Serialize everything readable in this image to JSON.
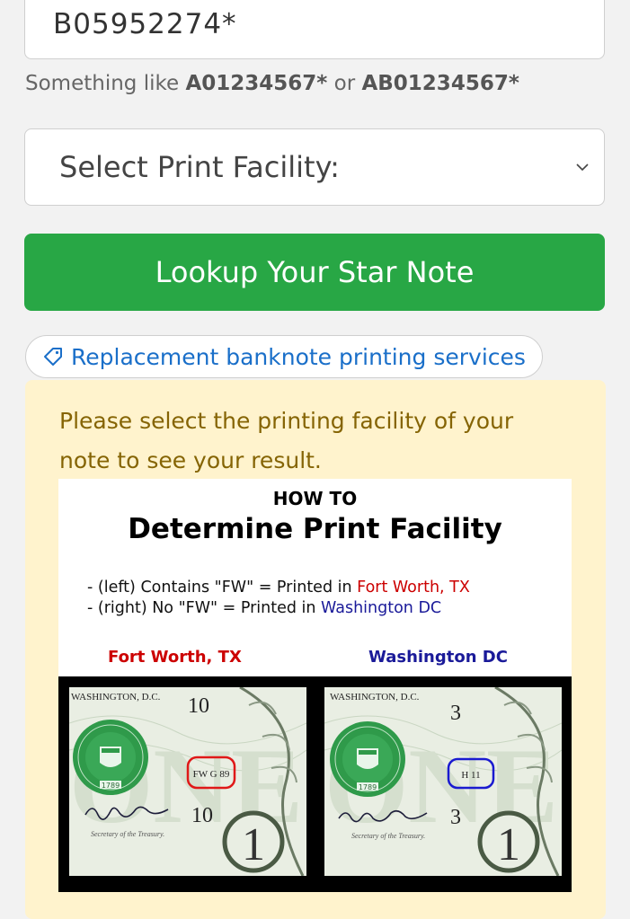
{
  "form": {
    "serial_value": "B05952274*",
    "hint_prefix": "Something like ",
    "hint_example1": "A01234567*",
    "hint_or": " or ",
    "hint_example2": "AB01234567*",
    "select_value": "Select Print Facility:",
    "lookup_label": "Lookup Your Star Note",
    "services_label": "Replacement banknote printing services"
  },
  "alert": {
    "text": "Please select the printing facility of your note to see your result."
  },
  "infographic": {
    "how_to": "HOW TO",
    "title": "Determine Print Facility",
    "rule1_prefix": "- (left) Contains \"FW\" = Printed in ",
    "rule1_place": "Fort Worth, TX",
    "rule2_prefix": "- (right) No \"FW\" = Printed in ",
    "rule2_place": "Washington DC",
    "label_left": "Fort Worth, TX",
    "label_right": "Washington DC",
    "left_note": {
      "header": "WASHINGTON, D.C.",
      "plate_number": "10",
      "check_letter": "FW G 89",
      "treasury_line": "Secretary of the Treasury.",
      "seal_year": "1789",
      "denomination": "1"
    },
    "right_note": {
      "header": "WASHINGTON, D.C.",
      "plate_number": "3",
      "check_letter": "H 11",
      "treasury_line": "Secretary of the Treasury.",
      "seal_year": "1789",
      "denomination": "1"
    }
  },
  "colors": {
    "button_green": "#28a745",
    "link_blue": "#1a6fc9",
    "alert_bg": "#fff3cd",
    "alert_text": "#856404",
    "fort_worth_red": "#cc0000",
    "washington_blue": "#1a1a99"
  }
}
